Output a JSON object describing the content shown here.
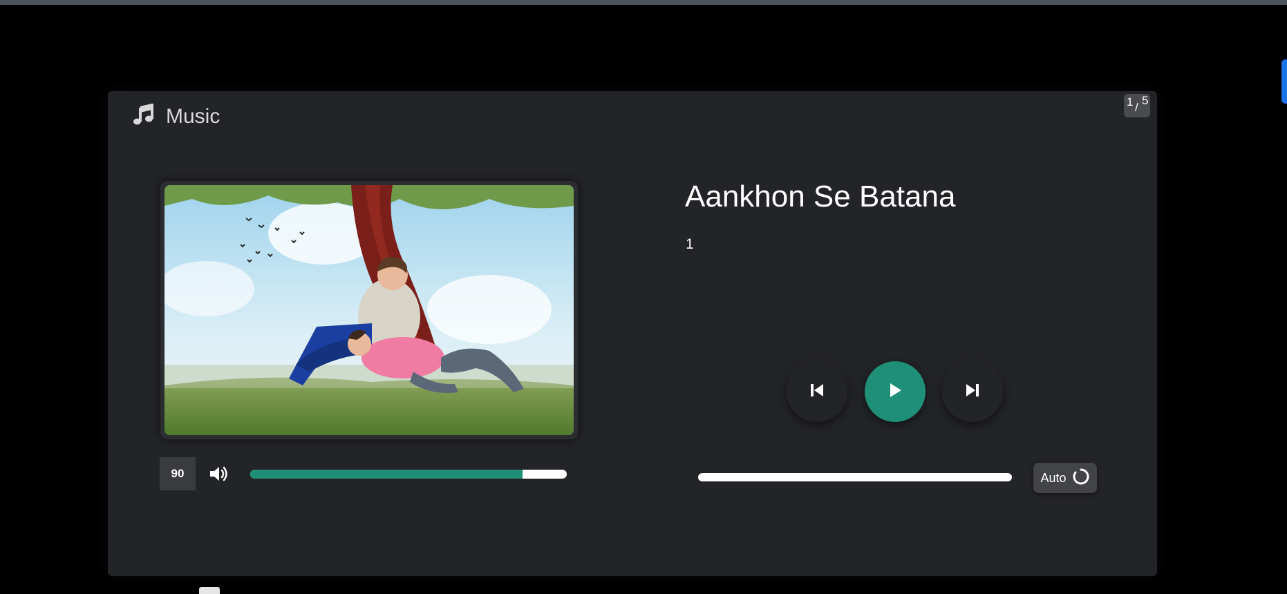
{
  "app": {
    "title": "Music",
    "icon": "music-note-icon"
  },
  "counter": {
    "current": "1",
    "separator": "/",
    "total": "5"
  },
  "song": {
    "title": "Aankhon Se Batana",
    "subtitle": "1"
  },
  "volume": {
    "value": "90",
    "level": 0.86,
    "icon": "volume-up-icon"
  },
  "controls": {
    "previous_icon": "skip-previous-icon",
    "play_icon": "play-icon",
    "next_icon": "skip-next-icon"
  },
  "seek": {
    "progress": 0
  },
  "autoplay": {
    "label": "Auto",
    "icon": "loop-icon"
  },
  "colors": {
    "accent": "#1f8f78",
    "card_bg": "#232427",
    "page_bg": "#000000"
  }
}
